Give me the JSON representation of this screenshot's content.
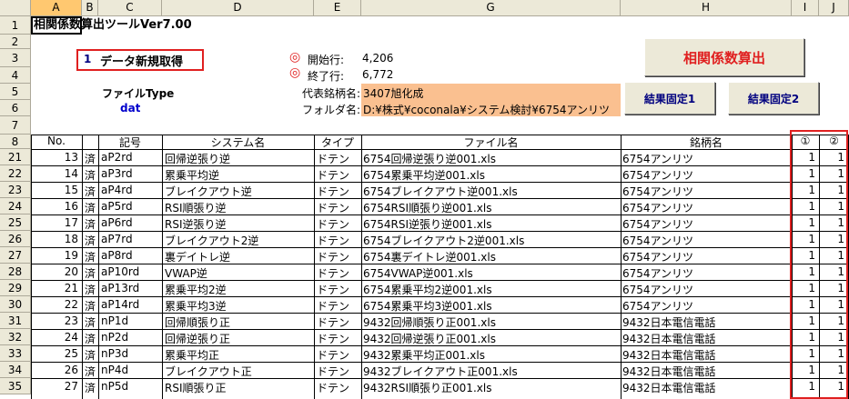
{
  "columns": [
    "A",
    "B",
    "C",
    "D",
    "E",
    "G",
    "H",
    "I",
    "J"
  ],
  "title": "相関係数算出ツールVer7.00",
  "data_button": {
    "num": "1",
    "label": "データ新規取得"
  },
  "start_row": {
    "mark": "◎",
    "label": "開始行:",
    "value": "4,206"
  },
  "end_row": {
    "mark": "◎",
    "label": "終了行:",
    "value": "6,772"
  },
  "rep_stock": {
    "label": "代表銘柄名:",
    "value": "3407旭化成"
  },
  "folder": {
    "label": "フォルダ名:",
    "value": "D:¥株式¥coconala¥システム検討¥6754アンリツ"
  },
  "file_type": {
    "label": "ファイルType",
    "value": "dat"
  },
  "buttons": {
    "calc": "相関係数算出",
    "fix1": "結果固定1",
    "fix2": "結果固定2"
  },
  "headers": {
    "no": "No.",
    "kigou": "記号",
    "system": "システム名",
    "type": "タイプ",
    "file": "ファイル名",
    "stock": "銘柄名",
    "c1": "①",
    "c2": "②"
  },
  "row_numbers": [
    "1",
    "2",
    "3",
    "4",
    "5",
    "6",
    "7",
    "8",
    "21",
    "22",
    "23",
    "24",
    "25",
    "26",
    "27",
    "28",
    "29",
    "30",
    "31",
    "32",
    "33",
    "34",
    "35"
  ],
  "rows": [
    {
      "no": "13",
      "done": "済",
      "kigou": "aP2rd",
      "system": "回帰逆張り逆",
      "type": "ドテン",
      "file": "6754回帰逆張り逆001.xls",
      "stock": "6754アンリツ",
      "v1": "1",
      "v2": "1"
    },
    {
      "no": "14",
      "done": "済",
      "kigou": "aP3rd",
      "system": "累乗平均逆",
      "type": "ドテン",
      "file": "6754累乗平均逆001.xls",
      "stock": "6754アンリツ",
      "v1": "1",
      "v2": "1"
    },
    {
      "no": "15",
      "done": "済",
      "kigou": "aP4rd",
      "system": "ブレイクアウト逆",
      "type": "ドテン",
      "file": "6754ブレイクアウト逆001.xls",
      "stock": "6754アンリツ",
      "v1": "1",
      "v2": "1"
    },
    {
      "no": "16",
      "done": "済",
      "kigou": "aP5rd",
      "system": "RSI順張り逆",
      "type": "ドテン",
      "file": "6754RSI順張り逆001.xls",
      "stock": "6754アンリツ",
      "v1": "1",
      "v2": "1"
    },
    {
      "no": "17",
      "done": "済",
      "kigou": "aP6rd",
      "system": "RSI逆張り逆",
      "type": "ドテン",
      "file": "6754RSI逆張り逆001.xls",
      "stock": "6754アンリツ",
      "v1": "1",
      "v2": "1"
    },
    {
      "no": "18",
      "done": "済",
      "kigou": "aP7rd",
      "system": "ブレイクアウト2逆",
      "type": "ドテン",
      "file": "6754ブレイクアウト2逆001.xls",
      "stock": "6754アンリツ",
      "v1": "1",
      "v2": "1"
    },
    {
      "no": "19",
      "done": "済",
      "kigou": "aP8rd",
      "system": "裏デイトレ逆",
      "type": "ドテン",
      "file": "6754裏デイトレ逆001.xls",
      "stock": "6754アンリツ",
      "v1": "1",
      "v2": "1"
    },
    {
      "no": "20",
      "done": "済",
      "kigou": "aP10rd",
      "system": "VWAP逆",
      "type": "ドテン",
      "file": "6754VWAP逆001.xls",
      "stock": "6754アンリツ",
      "v1": "1",
      "v2": "1"
    },
    {
      "no": "21",
      "done": "済",
      "kigou": "aP13rd",
      "system": "累乗平均2逆",
      "type": "ドテン",
      "file": "6754累乗平均2逆001.xls",
      "stock": "6754アンリツ",
      "v1": "1",
      "v2": "1"
    },
    {
      "no": "22",
      "done": "済",
      "kigou": "aP14rd",
      "system": "累乗平均3逆",
      "type": "ドテン",
      "file": "6754累乗平均3逆001.xls",
      "stock": "6754アンリツ",
      "v1": "1",
      "v2": "1"
    },
    {
      "no": "23",
      "done": "済",
      "kigou": "nP1d",
      "system": "回帰順張り正",
      "type": "ドテン",
      "file": "9432回帰順張り正001.xls",
      "stock": "9432日本電信電話",
      "v1": "1",
      "v2": "1"
    },
    {
      "no": "24",
      "done": "済",
      "kigou": "nP2d",
      "system": "回帰逆張り正",
      "type": "ドテン",
      "file": "9432回帰逆張り正001.xls",
      "stock": "9432日本電信電話",
      "v1": "1",
      "v2": "1"
    },
    {
      "no": "25",
      "done": "済",
      "kigou": "nP3d",
      "system": "累乗平均正",
      "type": "ドテン",
      "file": "9432累乗平均正001.xls",
      "stock": "9432日本電信電話",
      "v1": "1",
      "v2": "1"
    },
    {
      "no": "26",
      "done": "済",
      "kigou": "nP4d",
      "system": "ブレイクアウト正",
      "type": "ドテン",
      "file": "9432ブレイクアウト正001.xls",
      "stock": "9432日本電信電話",
      "v1": "1",
      "v2": "1"
    },
    {
      "no": "27",
      "done": "済",
      "kigou": "nP5d",
      "system": "RSI順張り正",
      "type": "ドテン",
      "file": "9432RSI順張り正001.xls",
      "stock": "9432日本電信電話",
      "v1": "1",
      "v2": "1"
    }
  ]
}
